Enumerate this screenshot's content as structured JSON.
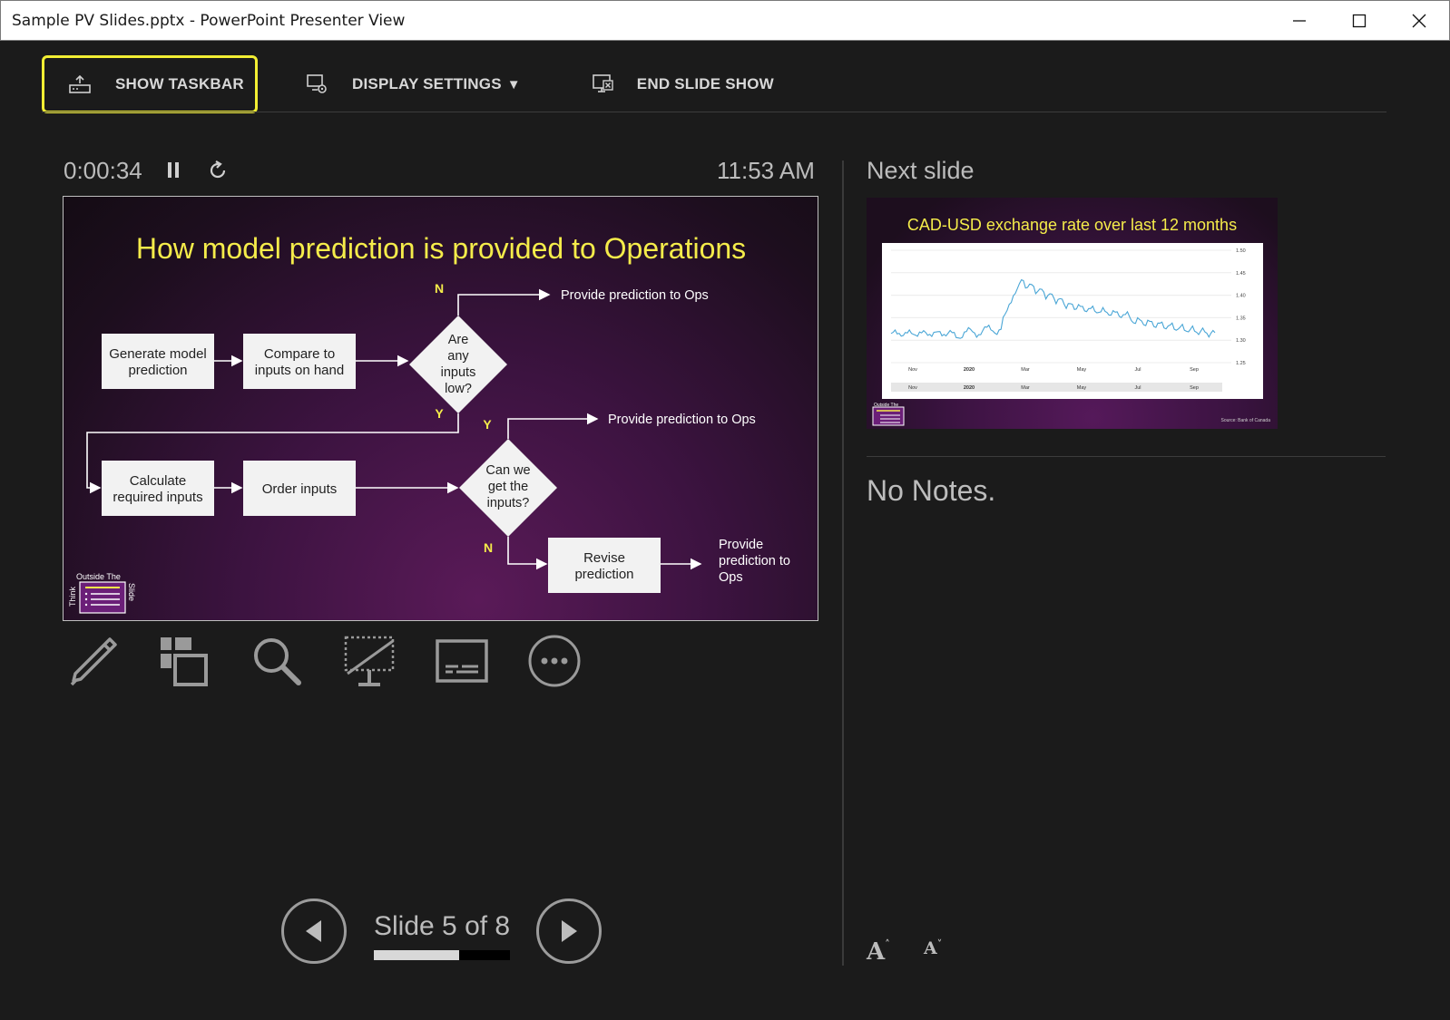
{
  "window": {
    "title": "Sample PV Slides.pptx - PowerPoint Presenter View"
  },
  "toolbar": {
    "show_taskbar": "SHOW TASKBAR",
    "display_settings": "DISPLAY SETTINGS",
    "display_settings_arrow": "▼",
    "end_slide_show": "END SLIDE SHOW"
  },
  "timer": {
    "elapsed": "0:00:34",
    "clock": "11:53 AM"
  },
  "current_slide": {
    "title": "How model prediction is provided to Operations",
    "boxes": {
      "generate_1": "Generate model",
      "generate_2": "prediction",
      "compare_1": "Compare to",
      "compare_2": "inputs on hand",
      "calc_1": "Calculate",
      "calc_2": "required inputs",
      "order": "Order inputs",
      "revise_1": "Revise",
      "revise_2": "prediction"
    },
    "diamonds": {
      "d1_1": "Are",
      "d1_2": "any",
      "d1_3": "inputs",
      "d1_4": "low?",
      "d2_1": "Can we",
      "d2_2": "get the",
      "d2_3": "inputs?"
    },
    "edges": {
      "n1": "N",
      "y1": "Y",
      "y2": "Y",
      "n2": "N",
      "ops1": "Provide prediction to Ops",
      "ops2": "Provide prediction to Ops",
      "ops3_1": "Provide",
      "ops3_2": "prediction to",
      "ops3_3": "Ops"
    },
    "logo": {
      "top": "Outside The",
      "left": "Think",
      "right": "Slide"
    }
  },
  "tools": [
    "pen-tool",
    "see-all-slides",
    "zoom",
    "black-screen",
    "subtitles",
    "more-options"
  ],
  "navigation": {
    "slide_label": "Slide 5 of 8",
    "progress_fraction": 0.625
  },
  "next_slide": {
    "label": "Next slide",
    "title": "CAD-USD exchange rate over last 12 months",
    "source": "Source: Bank of Canada",
    "logo_top": "Outside The",
    "x_ticks": [
      "Nov",
      "2020",
      "Mar",
      "May",
      "Jul",
      "Sep"
    ],
    "y_ticks": [
      "1.50",
      "1.45",
      "1.40",
      "1.35",
      "1.30",
      "1.25"
    ]
  },
  "notes": {
    "text": "No Notes."
  },
  "font_buttons": {
    "increase": "A",
    "decrease": "A"
  },
  "colors": {
    "highlight": "#f2ee33",
    "slide_title": "#f5ec4a",
    "accent_text": "#bcbcbc"
  }
}
